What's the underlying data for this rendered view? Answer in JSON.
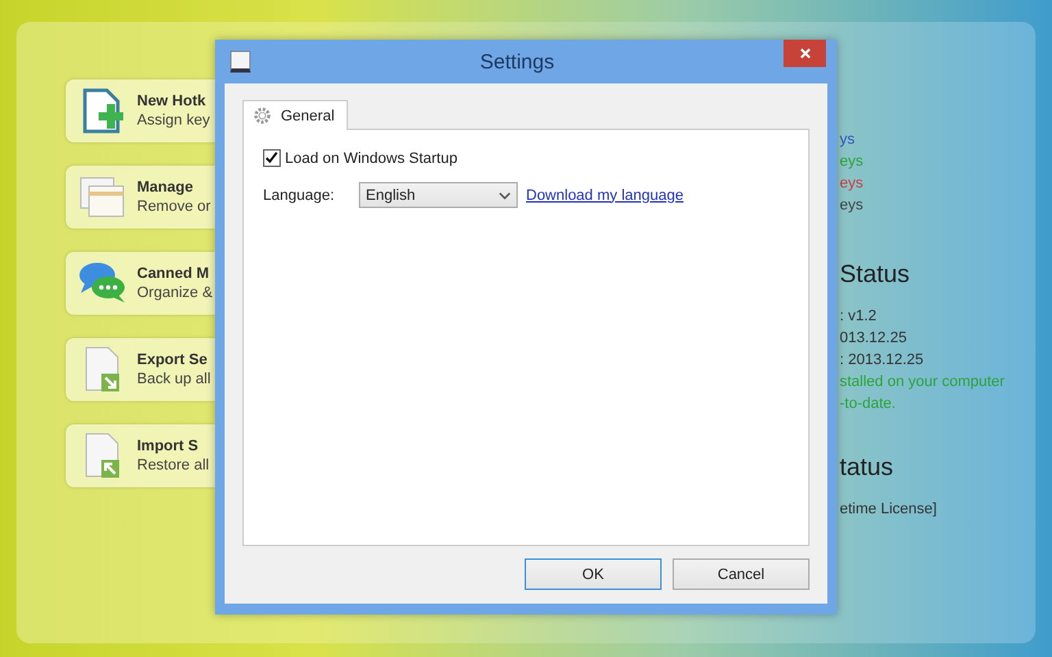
{
  "app": {
    "actions": [
      {
        "kind": "new",
        "title": "New Hotk",
        "subtitle": "Assign key"
      },
      {
        "kind": "manage",
        "title": "Manage",
        "subtitle": "Remove or"
      },
      {
        "kind": "canned",
        "title": "Canned M",
        "subtitle": "Organize &"
      },
      {
        "kind": "export",
        "title": "Export Se",
        "subtitle": "Back up all"
      },
      {
        "kind": "import",
        "title": "Import S",
        "subtitle": "Restore all"
      }
    ],
    "hotkey_counts": [
      {
        "text": "ys",
        "color": "#3355c0"
      },
      {
        "text": "eys",
        "color": "#2aa53a"
      },
      {
        "text": "eys",
        "color": "#c84040"
      },
      {
        "text": "eys",
        "color": "#444444"
      }
    ],
    "version_section": {
      "heading": "Status",
      "lines": [
        {
          "text": ": v1.2",
          "kind": "plain"
        },
        {
          "text": "013.12.25",
          "kind": "plain"
        },
        {
          "text": ": 2013.12.25",
          "kind": "plain"
        },
        {
          "text": "stalled on your computer",
          "kind": "ok"
        },
        {
          "text": "-to-date.",
          "kind": "ok"
        }
      ]
    },
    "license_section": {
      "heading": "tatus",
      "lines": [
        {
          "text": "etime License]",
          "kind": "plain"
        }
      ]
    }
  },
  "dialog": {
    "title": "Settings",
    "tabs": [
      {
        "label": "General",
        "selected": true
      }
    ],
    "startup": {
      "label": "Load on Windows Startup",
      "checked": true
    },
    "language": {
      "label": "Language:",
      "value": "English"
    },
    "link": "Download my language",
    "buttons": [
      {
        "label": "OK",
        "default": true
      },
      {
        "label": "Cancel",
        "default": false
      }
    ]
  }
}
